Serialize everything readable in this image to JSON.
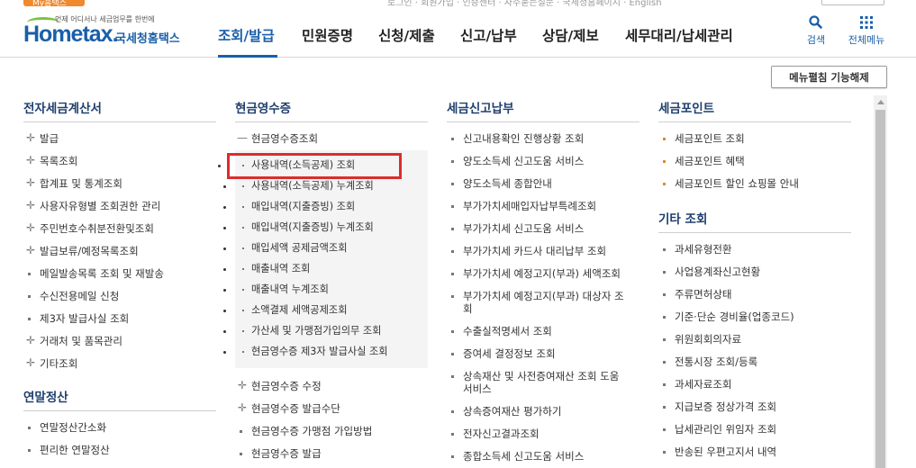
{
  "topstrip": {
    "my_tab": "My홈택스",
    "links": "로그인 · 회원가입 · 인증센터 · 자주묻는질문 · 국세청홈페이지 · English"
  },
  "logo": {
    "small": "언제 어디서나 세금업무를 한번에",
    "brand": "Hometax.",
    "korean": "국세청홈택스"
  },
  "gnb": [
    {
      "label": "조회/발급",
      "active": true
    },
    {
      "label": "민원증명"
    },
    {
      "label": "신청/제출"
    },
    {
      "label": "신고/납부"
    },
    {
      "label": "상담/제보"
    },
    {
      "label": "세무대리/납세관리"
    }
  ],
  "util": {
    "search": "검색",
    "allmenu": "전체메뉴"
  },
  "fold_button": "메뉴펼침 기능해제",
  "col1": {
    "title": "전자세금계산서",
    "items": [
      {
        "label": "발급",
        "mk": "plus"
      },
      {
        "label": "목록조회",
        "mk": "plus"
      },
      {
        "label": "합계표 및 통계조회",
        "mk": "plus"
      },
      {
        "label": "사용자유형별 조회권한 관리",
        "mk": "plus"
      },
      {
        "label": "주민번호수취분전환및조회",
        "mk": "plus"
      },
      {
        "label": "발급보류/예정목록조회",
        "mk": "plus"
      },
      {
        "label": "메일발송목록 조회 및 재발송",
        "mk": "dot"
      },
      {
        "label": "수신전용메일 신청",
        "mk": "dot"
      },
      {
        "label": "제3자 발급사실 조회",
        "mk": "dot"
      },
      {
        "label": "거래처 및 품목관리",
        "mk": "plus"
      },
      {
        "label": "기타조회",
        "mk": "plus"
      }
    ],
    "title2": "연말정산",
    "items2": [
      {
        "label": "연말정산간소화",
        "mk": "dot"
      },
      {
        "label": "편리한 연말정산",
        "mk": "dot"
      }
    ]
  },
  "col2": {
    "title": "현금영수증",
    "head": "현금영수증조회",
    "sub": [
      "사용내역(소득공제) 조회",
      "사용내역(소득공제) 누계조회",
      "매입내역(지출증빙) 조회",
      "매입내역(지출증빙) 누계조회",
      "매입세액 공제금액조회",
      "매출내역 조회",
      "매출내역 누계조회",
      "소액결제 세액공제조회",
      "가산세 및 가맹점가입의무 조회",
      "현금영수증 제3자 발급사실 조회"
    ],
    "items": [
      {
        "label": "현금영수증 수정",
        "mk": "plus"
      },
      {
        "label": "현금영수증 발급수단",
        "mk": "plus"
      },
      {
        "label": "현금영수증 가맹점 가입방법",
        "mk": "dot"
      },
      {
        "label": "현금영수증 발급",
        "mk": "dot"
      }
    ]
  },
  "col3": {
    "title": "세금신고납부",
    "items": [
      "신고내용확인 진행상황 조회",
      "양도소득세 신고도움 서비스",
      "양도소득세 종합안내",
      "부가가치세매입자납부특례조회",
      "부가가치세 신고도움 서비스",
      "부가가치세 카드사 대리납부 조회",
      "부가가치세 예정고지(부과) 세액조회",
      "부가가치세 예정고지(부과) 대상자 조회",
      "수출실적명세서 조회",
      "증여세 결정정보 조회",
      "상속재산 및 사전증여재산 조회 도움서비스",
      "상속증여재산 평가하기",
      "전자신고결과조회",
      "종합소득세 신고도움 서비스"
    ]
  },
  "col4": {
    "title": "세금포인트",
    "items": [
      "세금포인트 조회",
      "세금포인트 혜택",
      "세금포인트 할인 쇼핑몰 안내"
    ],
    "title2": "기타 조회",
    "items2": [
      "과세유형전환",
      "사업용계좌신고현황",
      "주류면허상태",
      "기준·단순 경비율(업종코드)",
      "위원회회의자료",
      "전통시장 조회/등록",
      "과세자료조회",
      "지급보증 정상가격 조회",
      "납세관리인 위임자 조회",
      "반송된 우편고지서 내역"
    ]
  }
}
